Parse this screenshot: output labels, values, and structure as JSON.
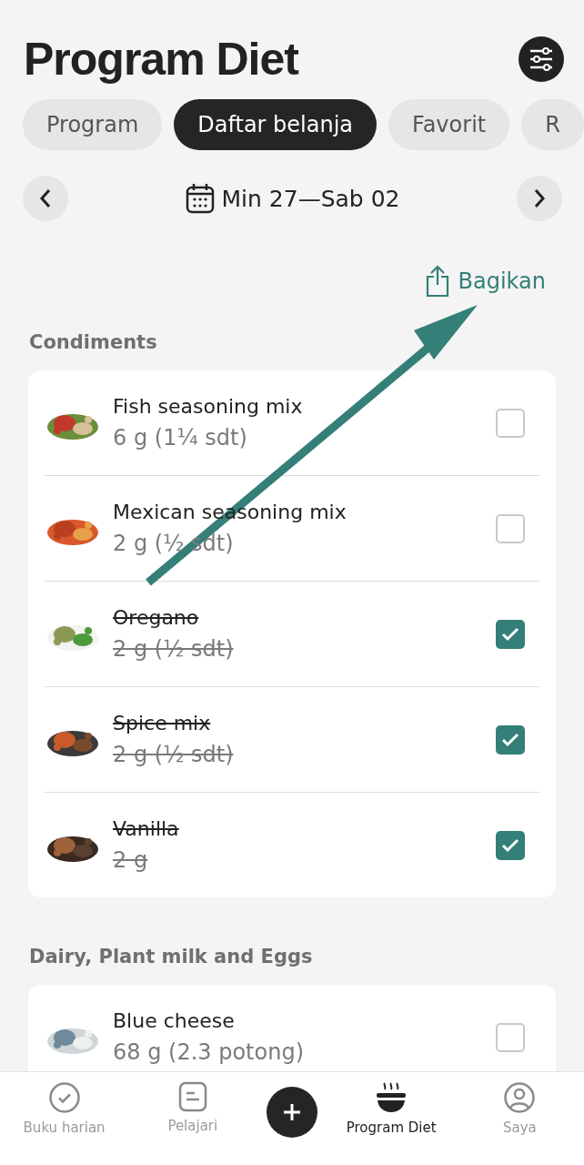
{
  "header": {
    "title": "Program Diet"
  },
  "tabs": [
    {
      "label": "Program",
      "selected": false
    },
    {
      "label": "Daftar belanja",
      "selected": true
    },
    {
      "label": "Favorit",
      "selected": false
    },
    {
      "label": "R",
      "selected": false
    }
  ],
  "date_range": {
    "label": "Min 27—Sab 02"
  },
  "share": {
    "label": "Bagikan"
  },
  "sections": [
    {
      "title": "Condiments",
      "items": [
        {
          "name": "Fish seasoning mix",
          "amount": "6 g (1¼ sdt)",
          "checked": false
        },
        {
          "name": "Mexican seasoning mix",
          "amount": "2 g (½ sdt)",
          "checked": false
        },
        {
          "name": "Oregano",
          "amount": "2 g (½ sdt)",
          "checked": true
        },
        {
          "name": "Spice mix",
          "amount": "2 g (½ sdt)",
          "checked": true
        },
        {
          "name": "Vanilla",
          "amount": "2 g",
          "checked": true
        }
      ]
    },
    {
      "title": "Dairy, Plant milk and Eggs",
      "items": [
        {
          "name": "Blue cheese",
          "amount": "68 g (2.3 potong)",
          "checked": false
        }
      ]
    }
  ],
  "bottom_nav": [
    {
      "kind": "diary",
      "label": "Buku harian",
      "selected": false
    },
    {
      "kind": "learn",
      "label": "Pelajari",
      "selected": false
    },
    {
      "kind": "add"
    },
    {
      "kind": "diet",
      "label": "Program Diet",
      "selected": true
    },
    {
      "kind": "profile",
      "label": "Saya",
      "selected": false
    }
  ]
}
